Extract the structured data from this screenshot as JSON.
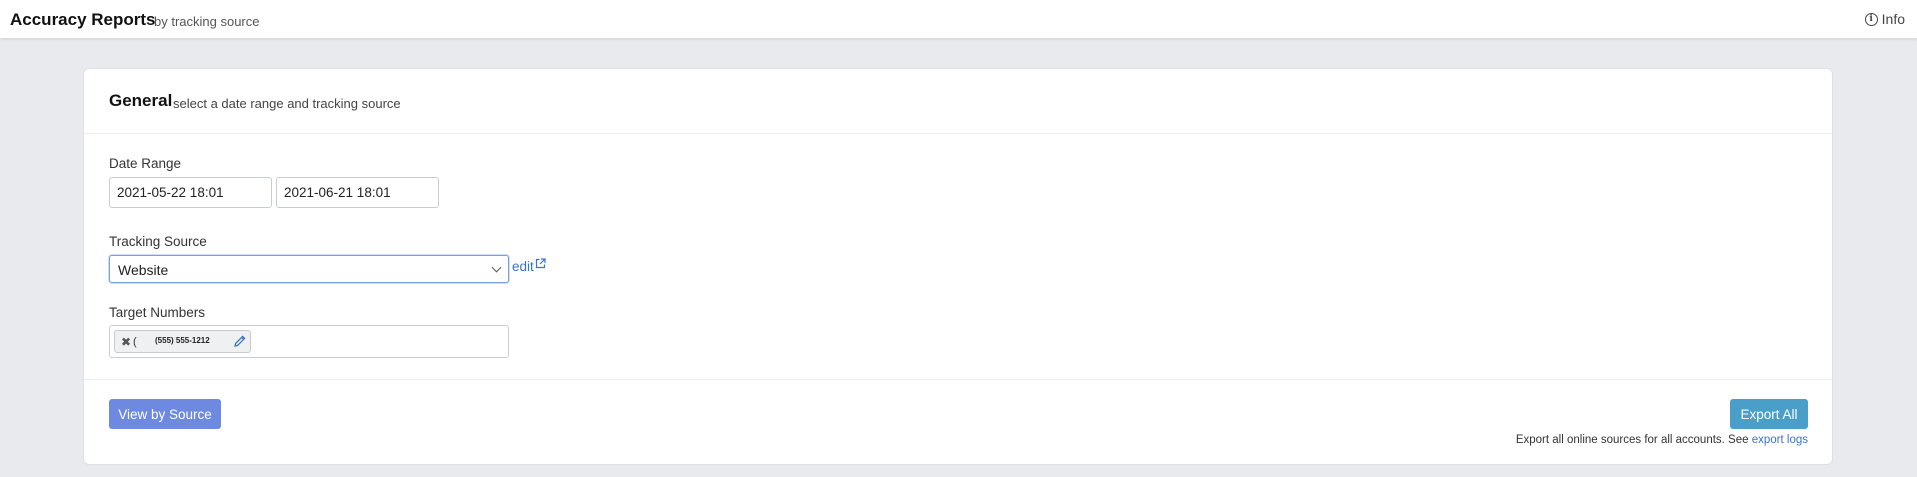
{
  "header": {
    "title": "Accuracy Reports",
    "subtitle": "by tracking source",
    "info_label": "Info"
  },
  "card": {
    "title": "General",
    "subtitle": "select a date range and tracking source"
  },
  "date_range": {
    "label": "Date Range",
    "start": "2021-05-22 18:01",
    "end": "2021-06-21 18:01"
  },
  "tracking_source": {
    "label": "Tracking Source",
    "selected": "Website",
    "edit_label": "edit"
  },
  "target_numbers": {
    "label": "Target Numbers",
    "tags": [
      {
        "prefix": "(",
        "number": "(555) 555-1212"
      }
    ]
  },
  "actions": {
    "view_by_source": "View by Source",
    "export_all": "Export All",
    "export_note": "Export all online sources for all accounts. See",
    "export_logs_link": "export logs"
  },
  "colors": {
    "accent": "#6d8ae0",
    "export_button": "#4a9fc9",
    "link": "#3b73c9",
    "background": "#e9eaee"
  }
}
